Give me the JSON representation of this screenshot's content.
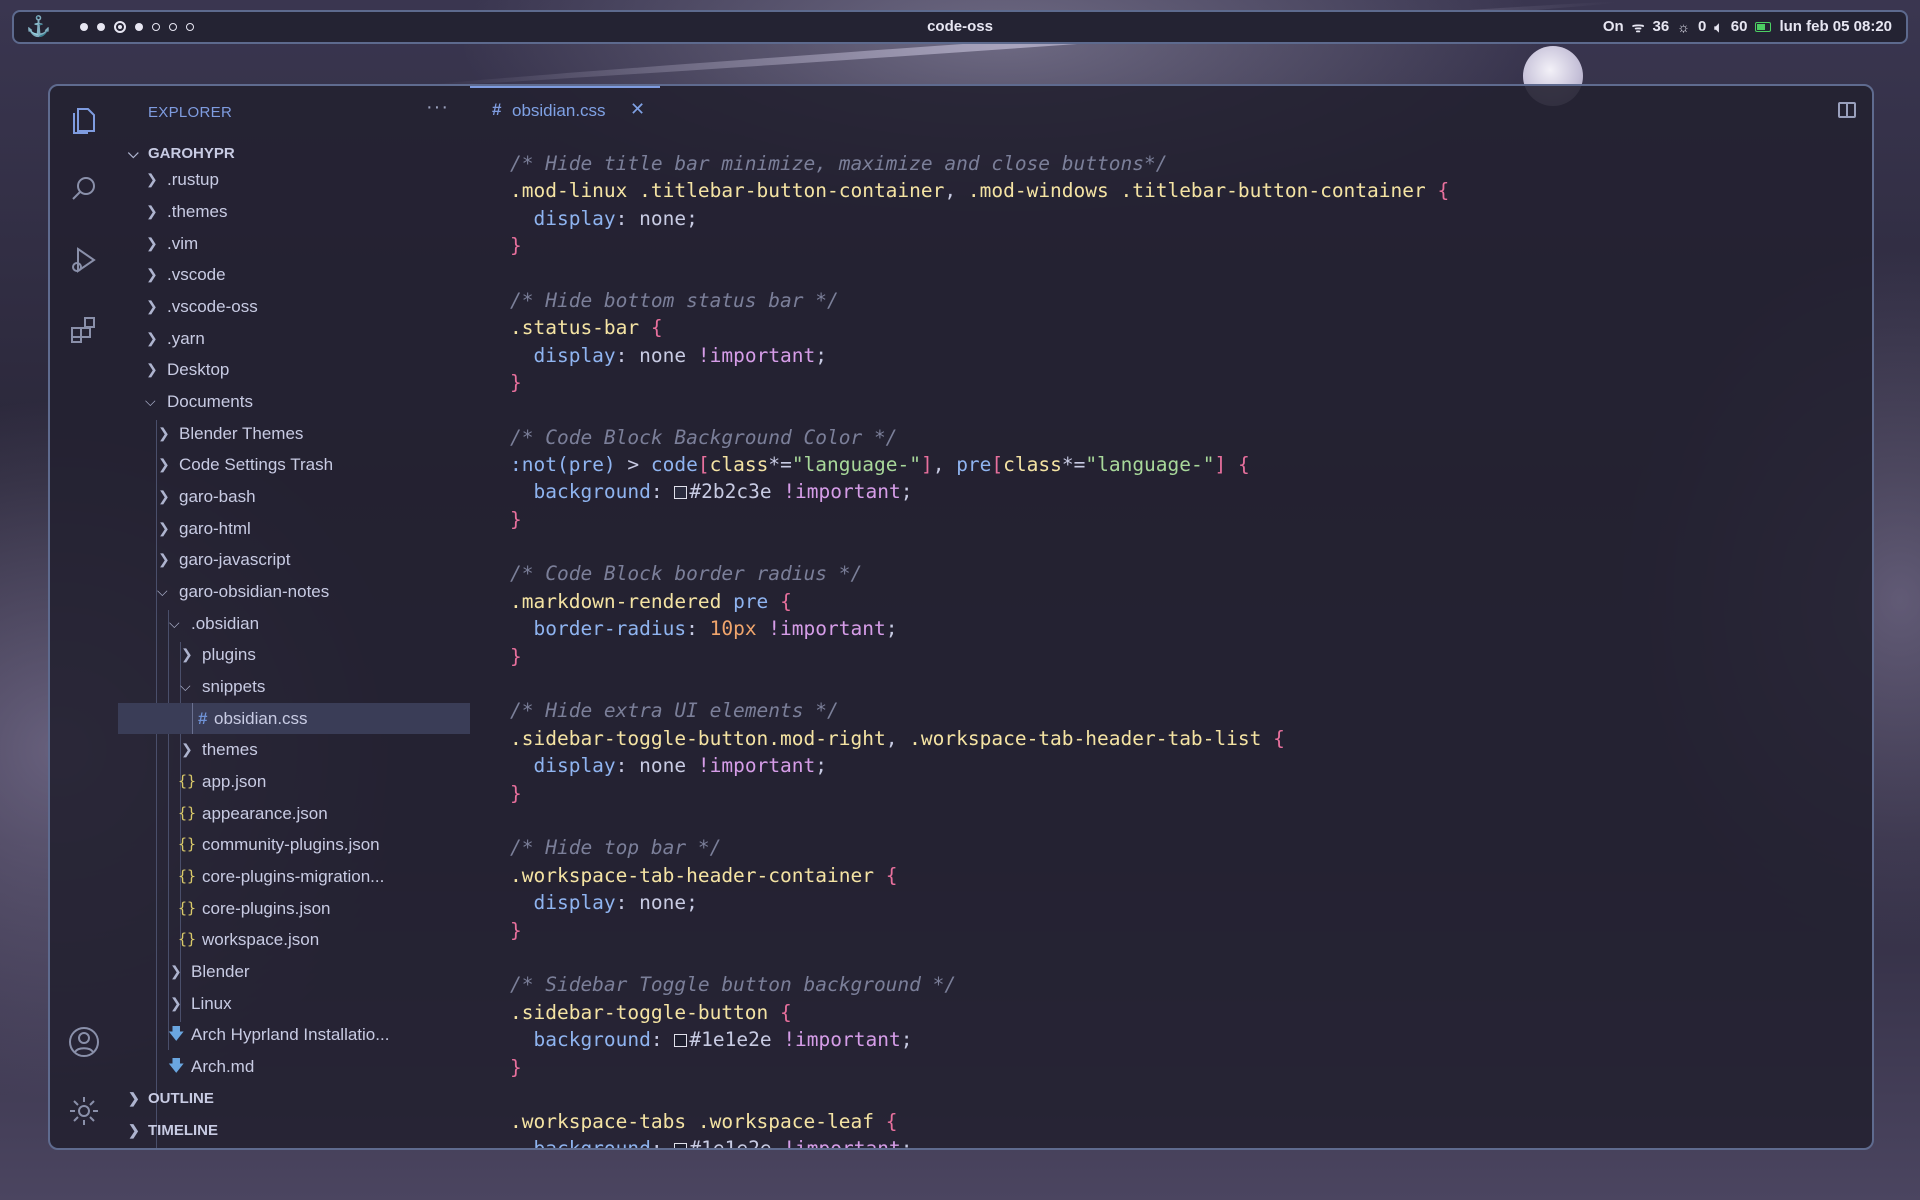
{
  "topbar": {
    "title": "code-oss",
    "network_label": "On",
    "brightness": "36",
    "mic": "0",
    "volume": "60",
    "datetime": "lun feb 05 08:20"
  },
  "explorer": {
    "header": "EXPLORER",
    "root": "GAROHYPR",
    "items": [
      {
        "label": ".rustup"
      },
      {
        "label": ".themes"
      },
      {
        "label": ".vim"
      },
      {
        "label": ".vscode"
      },
      {
        "label": ".vscode-oss"
      },
      {
        "label": ".yarn"
      },
      {
        "label": "Desktop"
      },
      {
        "label": "Documents"
      },
      {
        "label": "Blender Themes"
      },
      {
        "label": "Code Settings Trash"
      },
      {
        "label": "garo-bash"
      },
      {
        "label": "garo-html"
      },
      {
        "label": "garo-javascript"
      },
      {
        "label": "garo-obsidian-notes"
      },
      {
        "label": ".obsidian"
      },
      {
        "label": "plugins"
      },
      {
        "label": "snippets"
      },
      {
        "label": "obsidian.css"
      },
      {
        "label": "themes"
      },
      {
        "label": "app.json"
      },
      {
        "label": "appearance.json"
      },
      {
        "label": "community-plugins.json"
      },
      {
        "label": "core-plugins-migration..."
      },
      {
        "label": "core-plugins.json"
      },
      {
        "label": "workspace.json"
      },
      {
        "label": "Blender"
      },
      {
        "label": "Linux"
      },
      {
        "label": "Arch Hyprland Installatio..."
      },
      {
        "label": "Arch.md"
      }
    ],
    "outline": "OUTLINE",
    "timeline": "TIMELINE"
  },
  "tab": {
    "hash": "#",
    "name": "obsidian.css"
  },
  "code": {
    "l1_comment": "/* Hide title bar minimize, maximize and close buttons*/",
    "l2_sel1": ".mod-linux .titlebar-button-container",
    "l2_sep": ", ",
    "l2_sel2": ".mod-windows .titlebar-button-container",
    "brace_open": "{",
    "brace_close": "}",
    "prop_display": "display",
    "prop_background": "background",
    "prop_border_radius": "border-radius",
    "colon": ": ",
    "val_none": "none",
    "important": "!important",
    "semi": ";",
    "c2": "/* Hide bottom status bar */",
    "sel_status": ".status-bar",
    "c3": "/* Code Block Background Color */",
    "l3_not": ":not",
    "l3_pre": "(pre)",
    "l3_gt": " > ",
    "l3_code": "code",
    "l3_lb": "[",
    "l3_attr": "class",
    "l3_op": "*=",
    "l3_str": "\"language-\"",
    "l3_rb": "]",
    "l3_comma": ", ",
    "l3_pre2": "pre",
    "color_2b2c3e": "#2b2c3e",
    "c4": "/* Code Block border radius */",
    "sel_md": ".markdown-rendered",
    "sel_pre": "pre",
    "val_10px": "10px",
    "c5": "/* Hide extra UI elements */",
    "sel_sbt_mod": ".sidebar-toggle-button.mod-right",
    "sel_tablist": ".workspace-tab-header-tab-list",
    "c6": "/* Hide top bar */",
    "sel_thc": ".workspace-tab-header-container",
    "c7": "/* Sidebar Toggle button background */",
    "sel_sbt": ".sidebar-toggle-button",
    "color_1e1e2e": "#1e1e2e",
    "sel_wt": ".workspace-tabs",
    "sel_wl": ".workspace-leaf"
  },
  "colors": {
    "accent": "#7f9ce0",
    "comment": "#7b7f99",
    "selector": "#f4e3a3",
    "brace": "#e8709d"
  }
}
